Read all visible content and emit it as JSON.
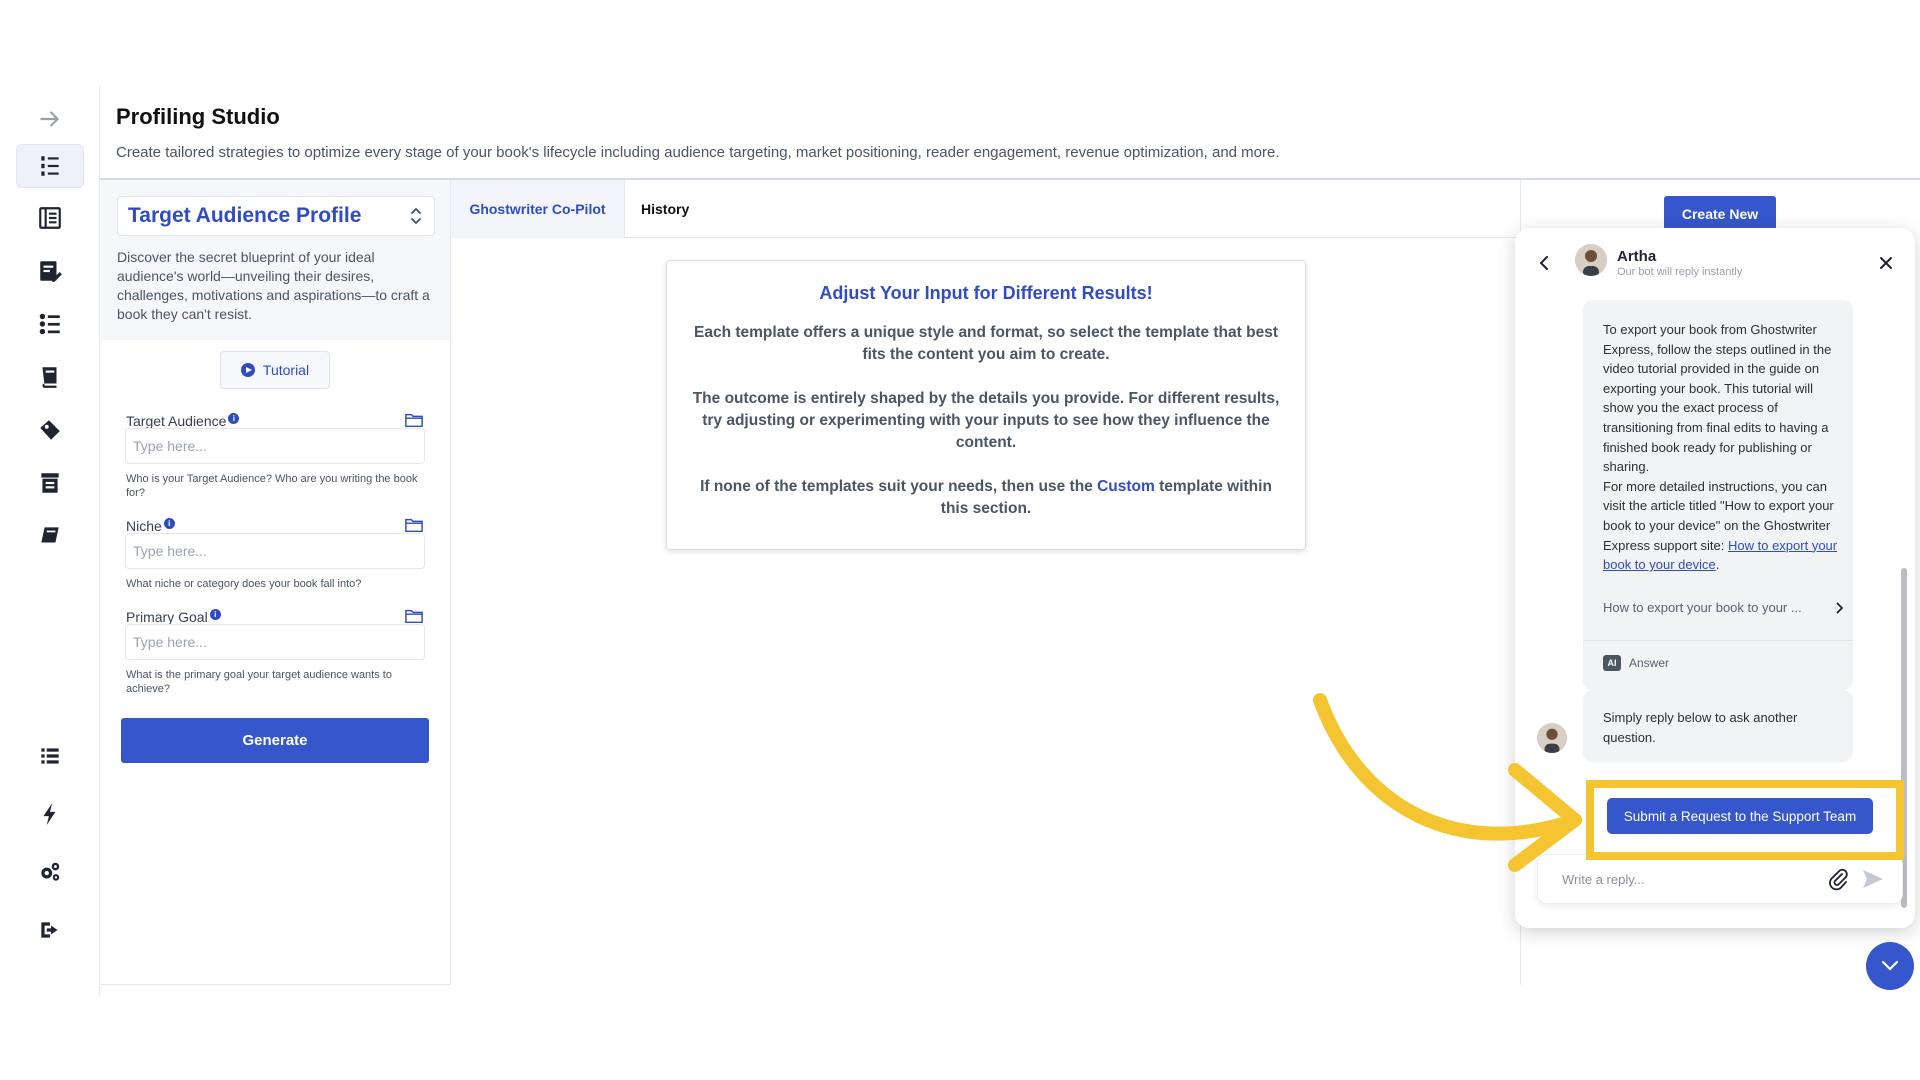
{
  "header": {
    "title": "Profiling Studio",
    "subtitle": "Create tailored strategies to optimize every stage of your book's lifecycle including audience targeting, market positioning, reader engagement, revenue optimization, and more."
  },
  "sidebar": {
    "items": [
      {
        "icon": "arrow-right-icon"
      },
      {
        "icon": "profiling-list-icon",
        "active": true
      },
      {
        "icon": "book-outline-icon"
      },
      {
        "icon": "edit-doc-icon"
      },
      {
        "icon": "numbered-list-icon"
      },
      {
        "icon": "book-stack-icon"
      },
      {
        "icon": "tag-icon"
      },
      {
        "icon": "archive-icon"
      },
      {
        "icon": "book-icon"
      },
      {
        "icon": "list-icon"
      },
      {
        "icon": "lightning-icon"
      },
      {
        "icon": "gears-icon"
      },
      {
        "icon": "logout-icon"
      }
    ]
  },
  "profile": {
    "selected": "Target Audience Profile",
    "description": "Discover the secret blueprint of your ideal audience's world—unveiling their desires, challenges, motivations and aspirations—to craft a book they can't resist."
  },
  "form": {
    "tutorial_label": "Tutorial",
    "fields": [
      {
        "label": "Target Audience",
        "placeholder": "Type here...",
        "help": "Who is your Target Audience? Who are you writing the book for?"
      },
      {
        "label": "Niche",
        "placeholder": "Type here...",
        "help": "What niche or category does your book fall into?"
      },
      {
        "label": "Primary Goal",
        "placeholder": "Type here...",
        "help": "What is the primary goal your target audience wants to achieve?"
      }
    ],
    "generate_label": "Generate"
  },
  "tabs": [
    {
      "label": "Ghostwriter Co-Pilot",
      "active": true
    },
    {
      "label": "History",
      "active": false
    }
  ],
  "info_card": {
    "title": "Adjust Your Input for Different Results!",
    "para1": "Each template offers a unique style and format, so select the template that best fits the content you aim to create.",
    "para2": "The outcome is entirely shaped by the details you provide. For different results, try adjusting or experimenting with your inputs to see how they influence the content.",
    "para3_before": "If none of the templates suit your needs, then use the ",
    "para3_link": "Custom",
    "para3_after": " template within this section."
  },
  "create_new_label": "Create New",
  "chat": {
    "agent_name": "Artha",
    "status": "Our bot will reply instantly",
    "message_text": "To export your book from Ghostwriter Express, follow the steps outlined in the video tutorial provided in the guide on exporting your book. This tutorial will show you the exact process of transitioning from final edits to having a finished book ready for publishing or sharing.",
    "message_text2": "For more detailed instructions, you can visit the article titled \"How to export your book to your device\" on the Ghostwriter Express support site: ",
    "message_link": "How to export your book to your device",
    "message_link_suffix": ".",
    "article_title": "How to export your book to your ...",
    "ai_badge": "AI",
    "answer_label": "Answer",
    "reply_prompt": "Simply reply below to ask another question.",
    "submit_label": "Submit a Request to the Support Team",
    "reply_placeholder": "Write a reply..."
  },
  "colors": {
    "accent": "#3656cc",
    "annotation": "#f5c531"
  }
}
